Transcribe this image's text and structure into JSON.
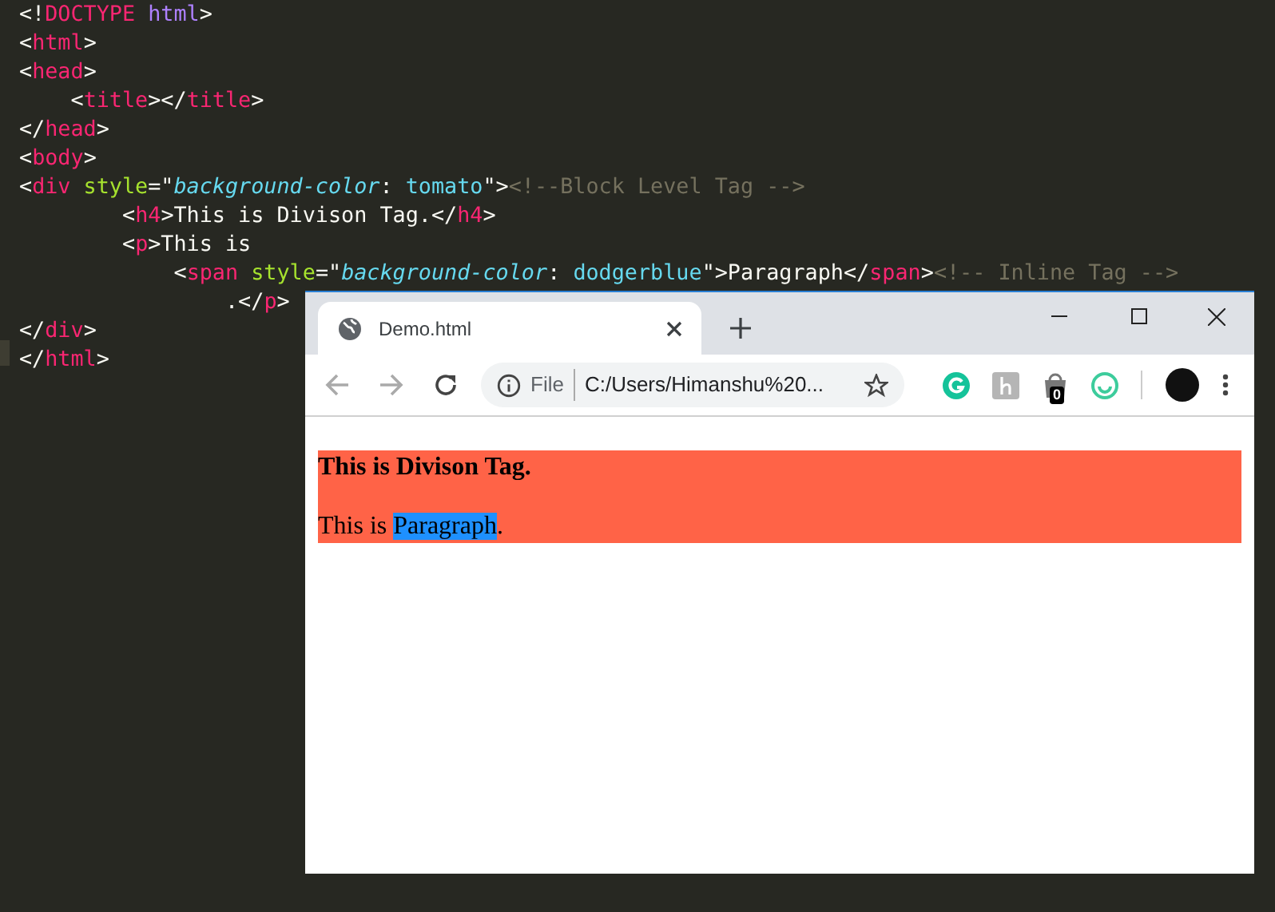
{
  "editor": {
    "lines": [
      [
        {
          "kind": "bracket",
          "text": "<!"
        },
        {
          "kind": "tag",
          "text": "DOCTYPE"
        },
        {
          "kind": "doctype",
          "text": " html"
        },
        {
          "kind": "bracket",
          "text": ">"
        }
      ],
      [
        {
          "kind": "bracket",
          "text": "<"
        },
        {
          "kind": "tag",
          "text": "html"
        },
        {
          "kind": "bracket",
          "text": ">"
        }
      ],
      [
        {
          "kind": "bracket",
          "text": "<"
        },
        {
          "kind": "tag",
          "text": "head"
        },
        {
          "kind": "bracket",
          "text": ">"
        }
      ],
      [
        {
          "kind": "bracket",
          "text": "    <"
        },
        {
          "kind": "tag",
          "text": "title"
        },
        {
          "kind": "bracket",
          "text": "></"
        },
        {
          "kind": "tag",
          "text": "title"
        },
        {
          "kind": "bracket",
          "text": ">"
        }
      ],
      [
        {
          "kind": "bracket",
          "text": "</"
        },
        {
          "kind": "tag",
          "text": "head"
        },
        {
          "kind": "bracket",
          "text": ">"
        }
      ],
      [
        {
          "kind": "bracket",
          "text": "<"
        },
        {
          "kind": "tag",
          "text": "body"
        },
        {
          "kind": "bracket",
          "text": ">"
        }
      ],
      [
        {
          "kind": "bracket",
          "text": "<"
        },
        {
          "kind": "tag",
          "text": "div"
        },
        {
          "kind": "attr",
          "text": " style"
        },
        {
          "kind": "bracket",
          "text": "=\""
        },
        {
          "kind": "property",
          "text": "background-color"
        },
        {
          "kind": "bracket",
          "text": ": "
        },
        {
          "kind": "value",
          "text": "tomato"
        },
        {
          "kind": "bracket",
          "text": "\">"
        },
        {
          "kind": "comment",
          "text": "<!--Block Level Tag -->"
        }
      ],
      [
        {
          "kind": "bracket",
          "text": "        <"
        },
        {
          "kind": "tag",
          "text": "h4"
        },
        {
          "kind": "bracket",
          "text": ">This is Divison Tag.</"
        },
        {
          "kind": "tag",
          "text": "h4"
        },
        {
          "kind": "bracket",
          "text": ">"
        }
      ],
      [
        {
          "kind": "bracket",
          "text": "        <"
        },
        {
          "kind": "tag",
          "text": "p"
        },
        {
          "kind": "bracket",
          "text": ">This is"
        }
      ],
      [
        {
          "kind": "bracket",
          "text": "            <"
        },
        {
          "kind": "tag",
          "text": "span"
        },
        {
          "kind": "attr",
          "text": " style"
        },
        {
          "kind": "bracket",
          "text": "=\""
        },
        {
          "kind": "property",
          "text": "background-color"
        },
        {
          "kind": "bracket",
          "text": ": "
        },
        {
          "kind": "value",
          "text": "dodgerblue"
        },
        {
          "kind": "bracket",
          "text": "\">Paragraph</"
        },
        {
          "kind": "tag",
          "text": "span"
        },
        {
          "kind": "bracket",
          "text": ">"
        },
        {
          "kind": "comment",
          "text": "<!-- Inline Tag -->"
        }
      ],
      [
        {
          "kind": "bracket",
          "text": "                .</"
        },
        {
          "kind": "tag",
          "text": "p"
        },
        {
          "kind": "bracket",
          "text": ">"
        }
      ],
      [
        {
          "kind": "bracket",
          "text": "</"
        },
        {
          "kind": "tag",
          "text": "div"
        },
        {
          "kind": "bracket",
          "text": ">"
        }
      ],
      [
        {
          "kind": "bracket",
          "text": "</"
        },
        {
          "kind": "tag",
          "text": "html"
        },
        {
          "kind": "bracket",
          "text": ">"
        }
      ]
    ]
  },
  "browser": {
    "tab": {
      "title": "Demo.html",
      "selected": true
    },
    "address": {
      "scheme": "File",
      "url": "C:/Users/Himanshu%20..."
    },
    "extension_badge": "0",
    "page": {
      "heading": "This is Divison Tag.",
      "paragraph_start": "This is ",
      "highlight": "Paragraph",
      "paragraph_end": "."
    }
  }
}
